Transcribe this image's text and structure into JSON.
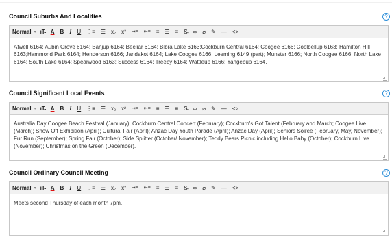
{
  "help_glyph": "?",
  "toolbar": {
    "format": "Normal",
    "caret": "▾",
    "font_size": "ıT̵",
    "font_color": "A",
    "bold": "B",
    "italic": "I",
    "underline": "U",
    "ordered_list": "⋮≡",
    "bullet_list": "☰",
    "subscript": "x₂",
    "superscript": "x²",
    "indent": "⇥≡",
    "outdent": "⇤≡",
    "align_left": "≡",
    "align_center": "☰",
    "align_right": "≡",
    "strikethrough": "S̶",
    "link": "∞",
    "unlink": "⌀",
    "highlighter": "✎",
    "horizontal_rule": "—",
    "source": "<>"
  },
  "fields": [
    {
      "label": "Council Suburbs And Localities",
      "content": "Atwell 6164; Aubin Grove 6164; Banjup 6164; Beeliar 6164; Bibra Lake 6163;Cockburn Central 6164; Coogee 6166; Coolbellup 6163; Hamilton Hill 6163;Hammond Park 6164; Henderson 6166; Jandakot 6164; Lake Coogee 6166; Leeming 6149 (part); Munster 6166; North Coogee 6166; North Lake 6164; South Lake 6164; Spearwood 6163; Success 6164; Treeby 6164; Wattleup 6166; Yangebup 6164."
    },
    {
      "label": "Council Significant Local Events",
      "content": "Australia Day Coogee Beach Festival (January); Cockburn Central Concert (February); Cockburn's Got Talent (February and March; Coogee Live (March); Show Off Exhibition (April); Cultural Fair (April); Anzac Day Youth Parade (April); Anzac Day (April); Seniors Soiree (February, May, November); Fur Run (September); Spring Fair (October); Side Splitter (October/ November); Teddy Bears Picnic including Hello Baby (October); Cockburn Live (November); Christmas on the Green (December)."
    },
    {
      "label": "Council Ordinary Council Meeting",
      "content": "Meets second Thursday of each month 7pm."
    }
  ]
}
